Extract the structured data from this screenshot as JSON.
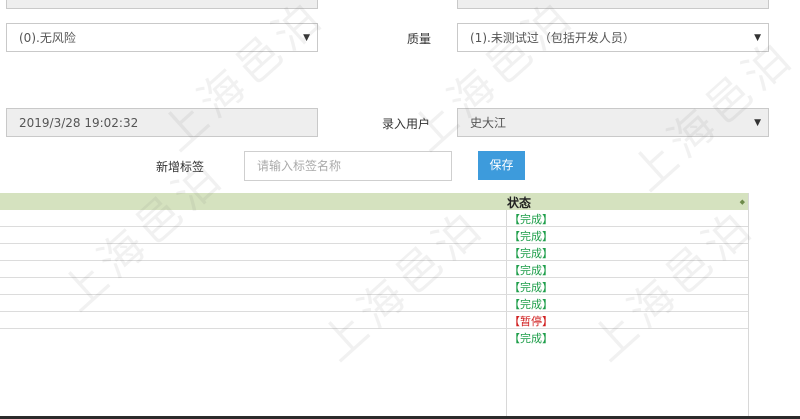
{
  "risk_select": {
    "value": "(0).无风险"
  },
  "quality": {
    "label": "质量",
    "value": "(1).未测试过（包括开发人员）"
  },
  "entry_time": {
    "value": "2019/3/28 19:02:32"
  },
  "entry_user": {
    "label": "录入用户",
    "value": "史大江"
  },
  "tag": {
    "label": "新增标签",
    "placeholder": "请输入标签名称",
    "save_label": "保存"
  },
  "table": {
    "status_header": "状态",
    "rows": [
      {
        "status": "【完成】",
        "color": "#1e9e4a"
      },
      {
        "status": "【完成】",
        "color": "#1e9e4a"
      },
      {
        "status": "【完成】",
        "color": "#1e9e4a"
      },
      {
        "status": "【完成】",
        "color": "#1e9e4a"
      },
      {
        "status": "【完成】",
        "color": "#1e9e4a"
      },
      {
        "status": "【完成】",
        "color": "#1e9e4a"
      },
      {
        "status": "【暂停】",
        "color": "#d02020"
      },
      {
        "status": "【完成】",
        "color": "#1e9e4a"
      }
    ]
  },
  "watermark": {
    "text": "上海邑泊"
  },
  "colors": {
    "accent": "#3d9bdc",
    "header_bg": "#d5e2bf",
    "done": "#1e9e4a",
    "paused": "#d02020"
  }
}
